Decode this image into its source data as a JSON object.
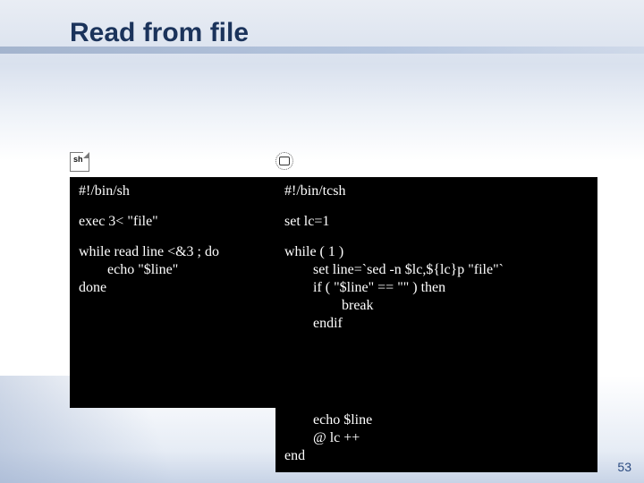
{
  "slide": {
    "title": "Read from file",
    "page_number": "53"
  },
  "icons": {
    "left": "sh-file-icon",
    "right": "csh-dotted-icon",
    "sh_label": "sh"
  },
  "code": {
    "left": {
      "shebang": "#!/bin/sh",
      "setup": "exec 3< \"file\"",
      "loop": "while read line <&3 ; do\n        echo \"$line\"\ndone"
    },
    "right": {
      "shebang": "#!/bin/tcsh",
      "setup": "set lc=1",
      "loop": "while ( 1 )\n        set line=`sed -n $lc,${lc}p \"file\"`\n        if ( \"$line\" == \"\" ) then\n                break\n        endif",
      "tail": "        echo $line\n        @ lc ++\nend"
    }
  }
}
